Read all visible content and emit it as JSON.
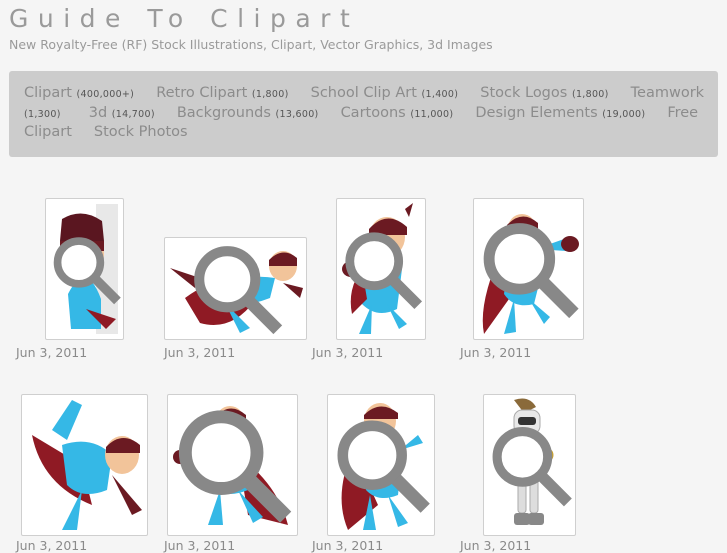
{
  "site": {
    "title": "Guide To Clipart",
    "tagline": "New Royalty-Free (RF) Stock Illustrations, Clipart, Vector Graphics, 3d Images"
  },
  "nav": {
    "line1": [
      {
        "label": "Clipart",
        "count": "(400,000+)"
      },
      {
        "label": "Retro Clipart",
        "count": "(1,800)"
      },
      {
        "label": "School Clip Art",
        "count": "(1,400)"
      },
      {
        "label": "Stock Logos",
        "count": "(1,800)"
      },
      {
        "label": "Teamwork",
        "count": ""
      }
    ],
    "line2": [
      {
        "label": "",
        "count": "(1,300)"
      },
      {
        "label": "3d",
        "count": "(14,700)"
      },
      {
        "label": "Backgrounds",
        "count": "(13,600)"
      },
      {
        "label": "Cartoons",
        "count": "(11,000)"
      },
      {
        "label": "Design Elements",
        "count": "(19,000)"
      },
      {
        "label": "Free",
        "count": ""
      }
    ],
    "line3": [
      {
        "label": "Clipart",
        "count": ""
      },
      {
        "label": "Stock Photos",
        "count": ""
      }
    ]
  },
  "gallery": {
    "row1": [
      {
        "date": "Jun 3, 2011",
        "pose": "peek",
        "icon": "zoom-icon"
      },
      {
        "date": "Jun 3, 2011",
        "pose": "flying",
        "icon": "zoom-icon"
      },
      {
        "date": "Jun 3, 2011",
        "pose": "punch",
        "icon": "zoom-icon"
      },
      {
        "date": "Jun 3, 2011",
        "pose": "punch-side",
        "icon": "zoom-icon"
      }
    ],
    "row2": [
      {
        "date": "Jun 3, 2011",
        "pose": "kick"
      },
      {
        "date": "Jun 3, 2011",
        "pose": "point"
      },
      {
        "date": "Jun 3, 2011",
        "pose": "stand"
      },
      {
        "date": "Jun 3, 2011",
        "pose": "robot"
      }
    ]
  },
  "colors": {
    "suit": "#35b8e6",
    "cape": "#8f1a24",
    "mask": "#6b1a22",
    "skin": "#f2c49a",
    "nav_bg": "#cccccc"
  }
}
